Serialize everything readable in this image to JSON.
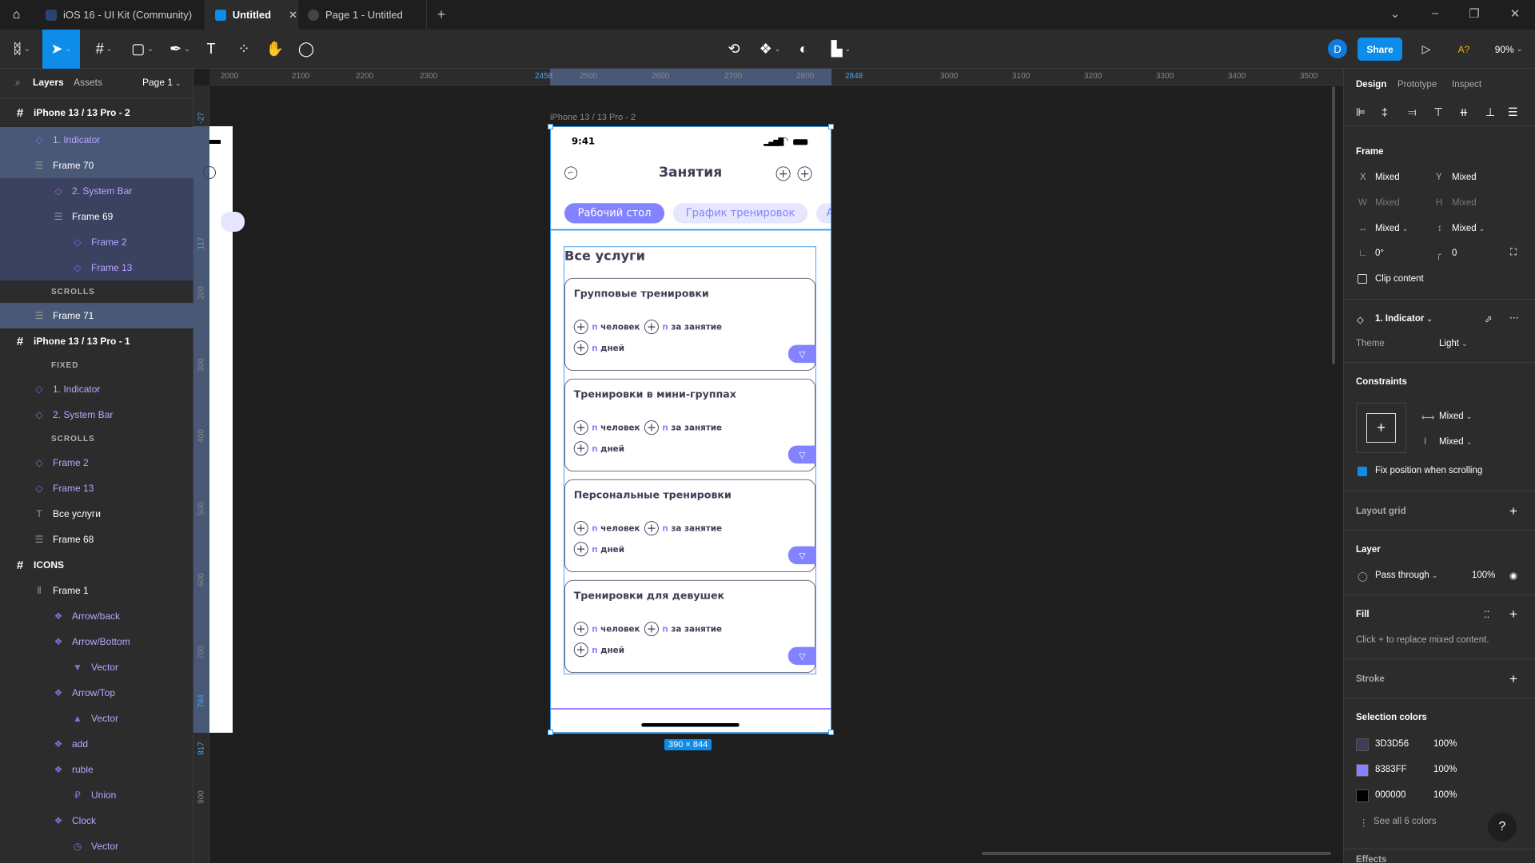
{
  "tabs": [
    {
      "label": "iOS 16 - UI Kit (Community)"
    },
    {
      "label": "Untitled",
      "close": "✕"
    },
    {
      "label": "Page 1 - Untitled"
    }
  ],
  "new_tab": "+",
  "window": {
    "chevron": "⌄",
    "minimize": "–",
    "maximize": "❐",
    "close": "✕"
  },
  "toolbar": {
    "share": "Share",
    "avatar": "D",
    "ask": "A?",
    "zoom": "90%"
  },
  "left_panel": {
    "layers": "Layers",
    "assets": "Assets",
    "page": "Page 1",
    "rows": [
      {
        "type": "top",
        "level": 0,
        "icon": "#",
        "label": "iPhone 13 / 13 Pro - 2"
      },
      {
        "type": "comp",
        "level": 1,
        "icon": "◇",
        "label": "1. Indicator",
        "hl": 1
      },
      {
        "type": "frame",
        "level": 1,
        "icon": "☰",
        "label": "Frame 70",
        "hl": 1
      },
      {
        "type": "comp",
        "level": 2,
        "icon": "◇",
        "label": "2. System Bar",
        "hl": 2
      },
      {
        "type": "frame",
        "level": 2,
        "icon": "☰",
        "label": "Frame 69",
        "hl": 2
      },
      {
        "type": "comp",
        "level": 3,
        "icon": "◇",
        "label": "Frame 2",
        "hl": 2
      },
      {
        "type": "comp",
        "level": 3,
        "icon": "◇",
        "label": "Frame 13",
        "hl": 2
      },
      {
        "type": "sec",
        "level": 1,
        "label": "SCROLLS"
      },
      {
        "type": "frame",
        "level": 1,
        "icon": "☰",
        "label": "Frame 71",
        "hl": 1
      },
      {
        "type": "top",
        "level": 0,
        "icon": "#",
        "label": "iPhone 13 / 13 Pro - 1"
      },
      {
        "type": "sec",
        "level": 1,
        "label": "FIXED"
      },
      {
        "type": "comp",
        "level": 1,
        "icon": "◇",
        "label": "1. Indicator"
      },
      {
        "type": "comp",
        "level": 1,
        "icon": "◇",
        "label": "2. System Bar"
      },
      {
        "type": "sec",
        "level": 1,
        "label": "SCROLLS"
      },
      {
        "type": "comp",
        "level": 1,
        "icon": "◇",
        "label": "Frame 2"
      },
      {
        "type": "comp",
        "level": 1,
        "icon": "◇",
        "label": "Frame 13"
      },
      {
        "type": "frame",
        "level": 1,
        "icon": "T",
        "label": "Все услуги"
      },
      {
        "type": "frame",
        "level": 1,
        "icon": "☰",
        "label": "Frame 68"
      },
      {
        "type": "top",
        "level": 0,
        "icon": "#",
        "label": "ICONS"
      },
      {
        "type": "frame",
        "level": 1,
        "icon": "⫴",
        "label": "Frame 1"
      },
      {
        "type": "comp",
        "level": 2,
        "icon": "❖",
        "label": "Arrow/back"
      },
      {
        "type": "comp",
        "level": 2,
        "icon": "❖",
        "label": "Arrow/Bottom"
      },
      {
        "type": "comp",
        "level": 3,
        "icon": "▼",
        "label": "Vector"
      },
      {
        "type": "comp",
        "level": 2,
        "icon": "❖",
        "label": "Arrow/Top"
      },
      {
        "type": "comp",
        "level": 3,
        "icon": "▲",
        "label": "Vector"
      },
      {
        "type": "comp",
        "level": 2,
        "icon": "❖",
        "label": "add"
      },
      {
        "type": "comp",
        "level": 2,
        "icon": "❖",
        "label": "ruble"
      },
      {
        "type": "comp",
        "level": 3,
        "icon": "₽",
        "label": "Union"
      },
      {
        "type": "comp",
        "level": 2,
        "icon": "❖",
        "label": "Clock"
      },
      {
        "type": "comp",
        "level": 3,
        "icon": "◷",
        "label": "Vector"
      }
    ]
  },
  "rulers": {
    "h": [
      {
        "t": "2000"
      },
      {
        "t": "2100"
      },
      {
        "t": "2200"
      },
      {
        "t": "2300"
      },
      {
        "t": "2458",
        "b": 1
      },
      {
        "t": "2500"
      },
      {
        "t": "2600"
      },
      {
        "t": "2700"
      },
      {
        "t": "2800"
      },
      {
        "t": "2848",
        "b": 1
      },
      {
        "t": "3000"
      },
      {
        "t": "3100"
      },
      {
        "t": "3200"
      },
      {
        "t": "3300"
      },
      {
        "t": "3400"
      },
      {
        "t": "3500"
      }
    ],
    "v": [
      {
        "t": "-27",
        "b": 1
      },
      {
        "t": "117",
        "b": 1
      },
      {
        "t": "200"
      },
      {
        "t": "300"
      },
      {
        "t": "400"
      },
      {
        "t": "500"
      },
      {
        "t": "600"
      },
      {
        "t": "700"
      },
      {
        "t": "784",
        "b": 1
      },
      {
        "t": "817",
        "b": 1
      },
      {
        "t": "900"
      }
    ]
  },
  "canvas": {
    "frame_name": "iPhone 13 / 13 Pro - 2",
    "size_badge": "390 × 844"
  },
  "phone": {
    "time": "9:41",
    "title": "Занятия",
    "tabs": [
      "Рабочий стол",
      "График тренировок",
      "А"
    ],
    "section_title": "Все услуги",
    "cards": [
      {
        "title": "Групповые тренировки",
        "chips": [
          {
            "n": "n",
            "label": "человек"
          },
          {
            "n": "n",
            "label": "за занятие"
          },
          {
            "n": "n",
            "label": "дней"
          }
        ]
      },
      {
        "title": "Тренировки в мини-группах",
        "chips": [
          {
            "n": "n",
            "label": "человек"
          },
          {
            "n": "n",
            "label": "за занятие"
          },
          {
            "n": "n",
            "label": "дней"
          }
        ]
      },
      {
        "title": "Персональные тренировки",
        "chips": [
          {
            "n": "n",
            "label": "человек"
          },
          {
            "n": "n",
            "label": "за занятие"
          },
          {
            "n": "n",
            "label": "дней"
          }
        ]
      },
      {
        "title": "Тренировки для девушек",
        "chips": [
          {
            "n": "n",
            "label": "человек"
          },
          {
            "n": "n",
            "label": "за занятие"
          },
          {
            "n": "n",
            "label": "дней"
          }
        ]
      }
    ],
    "colors": {
      "text": "#3D3D56",
      "accent": "#8383FF",
      "tab_bg": "#E6E6FF"
    }
  },
  "right_panel": {
    "tabs": [
      "Design",
      "Prototype",
      "Inspect"
    ],
    "frame_label": "Frame",
    "x_label": "X",
    "x": "Mixed",
    "y_label": "Y",
    "y": "Mixed",
    "w_label": "W",
    "w": "Mixed",
    "h_label": "H",
    "h": "Mixed",
    "hresize": "Mixed",
    "vresize": "Mixed",
    "rotation": "0°",
    "radius": "0",
    "clip": "Clip content",
    "component": "1. Indicator",
    "theme_label": "Theme",
    "theme": "Light",
    "constraints": "Constraints",
    "c_h": "Mixed",
    "c_v": "Mixed",
    "fix_scroll": "Fix position when scrolling",
    "layout_grid": "Layout grid",
    "layer": "Layer",
    "blend": "Pass through",
    "opacity": "100%",
    "fill": "Fill",
    "fill_hint": "Click + to replace mixed content.",
    "stroke": "Stroke",
    "selection_colors": "Selection colors",
    "colors": [
      {
        "hex": "3D3D56",
        "pct": "100%",
        "color": "#3D3D56"
      },
      {
        "hex": "8383FF",
        "pct": "100%",
        "color": "#8383FF"
      },
      {
        "hex": "000000",
        "pct": "100%",
        "color": "#000000"
      }
    ],
    "see_all": "See all 6 colors",
    "effects": "Effects",
    "help": "?"
  }
}
